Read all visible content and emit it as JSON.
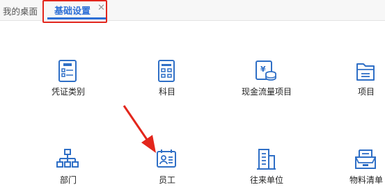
{
  "tabs": {
    "home_label": "我的桌面",
    "active_label": "基础设置",
    "close_glyph": "✕"
  },
  "items": [
    {
      "label": "凭证类别",
      "icon": "voucher-icon"
    },
    {
      "label": "科目",
      "icon": "account-list-icon"
    },
    {
      "label": "现金流量项目",
      "icon": "cash-flow-icon"
    },
    {
      "label": "项目",
      "icon": "folder-icon"
    },
    {
      "label": "部门",
      "icon": "org-chart-icon"
    },
    {
      "label": "员工",
      "icon": "employee-card-icon"
    },
    {
      "label": "往来单位",
      "icon": "building-icon"
    },
    {
      "label": "物料清单",
      "icon": "tray-icon"
    }
  ],
  "colors": {
    "accent": "#2d6fd6",
    "highlight": "#e3261c",
    "icon": "#2f6fc6"
  }
}
